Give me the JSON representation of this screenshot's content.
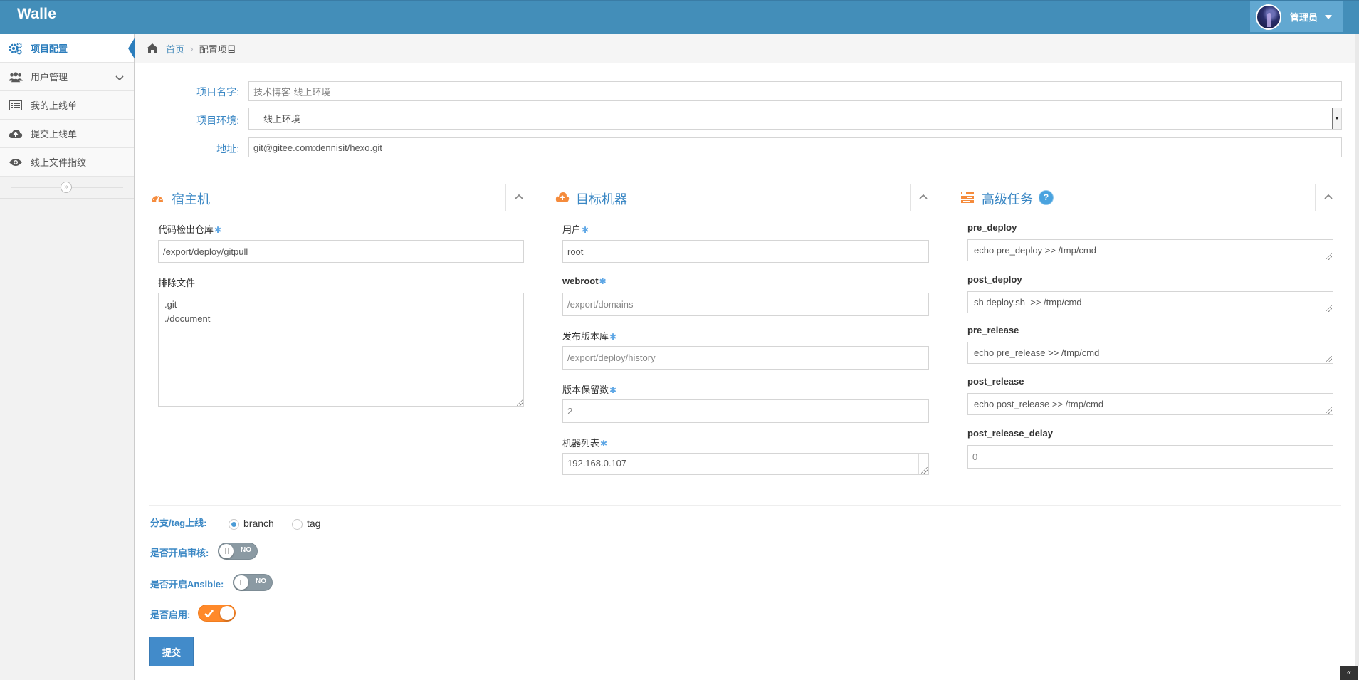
{
  "brand": "Walle",
  "user": {
    "name": "管理员"
  },
  "sidebar": {
    "items": [
      {
        "label": "项目配置",
        "icon": "cogs-icon",
        "active": true
      },
      {
        "label": "用户管理",
        "icon": "users-icon",
        "has_submenu": true
      },
      {
        "label": "我的上线单",
        "icon": "list-icon"
      },
      {
        "label": "提交上线单",
        "icon": "cloud-upload-icon"
      },
      {
        "label": "线上文件指纹",
        "icon": "eye-icon"
      }
    ],
    "toggle_glyph": "»"
  },
  "breadcrumb": {
    "home": "首页",
    "separator": "›",
    "current": "配置项目"
  },
  "project": {
    "name_label": "项目名字:",
    "name_value": "技术博客-线上环境",
    "env_label": "项目环境:",
    "env_value": "线上环境",
    "addr_label": "地址:",
    "addr_value": "git@gitee.com:dennisit/hexo.git"
  },
  "host": {
    "title": "宿主机",
    "repo_label": "代码检出仓库",
    "repo_value": "/export/deploy/gitpull",
    "exclude_label": "排除文件",
    "exclude_value": ".git\n./document"
  },
  "target": {
    "title": "目标机器",
    "user_label": "用户",
    "user_value": "root",
    "webroot_label": "webroot",
    "webroot_value": "/export/domains",
    "release_label": "发布版本库",
    "release_value": "/export/deploy/history",
    "keep_label": "版本保留数",
    "keep_value": "2",
    "hosts_label": "机器列表",
    "hosts_value": "192.168.0.107"
  },
  "tasks": {
    "title": "高级任务",
    "help": "?",
    "pre_deploy_label": "pre_deploy",
    "pre_deploy_value": "echo pre_deploy >> /tmp/cmd",
    "post_deploy_label": "post_deploy",
    "post_deploy_value": "sh deploy.sh  >> /tmp/cmd",
    "pre_release_label": "pre_release",
    "pre_release_value": "echo pre_release >> /tmp/cmd",
    "post_release_label": "post_release",
    "post_release_value": "echo post_release >> /tmp/cmd",
    "delay_label": "post_release_delay",
    "delay_value": "0"
  },
  "required_mark": "✱",
  "options": {
    "mode_label": "分支/tag上线:",
    "branch_label": "branch",
    "tag_label": "tag",
    "audit_label": "是否开启审核:",
    "audit_state": "NO",
    "ansible_label": "是否开启Ansible:",
    "ansible_state": "NO",
    "enable_label": "是否启用:"
  },
  "submit_label": "提交",
  "scroll_top_glyph": "«",
  "colors": {
    "navbar": "#438eb9",
    "accent": "#3a87c4",
    "toggle_on": "#ff892a",
    "toggle_off": "#8b9aa3",
    "submit": "#428bca"
  }
}
